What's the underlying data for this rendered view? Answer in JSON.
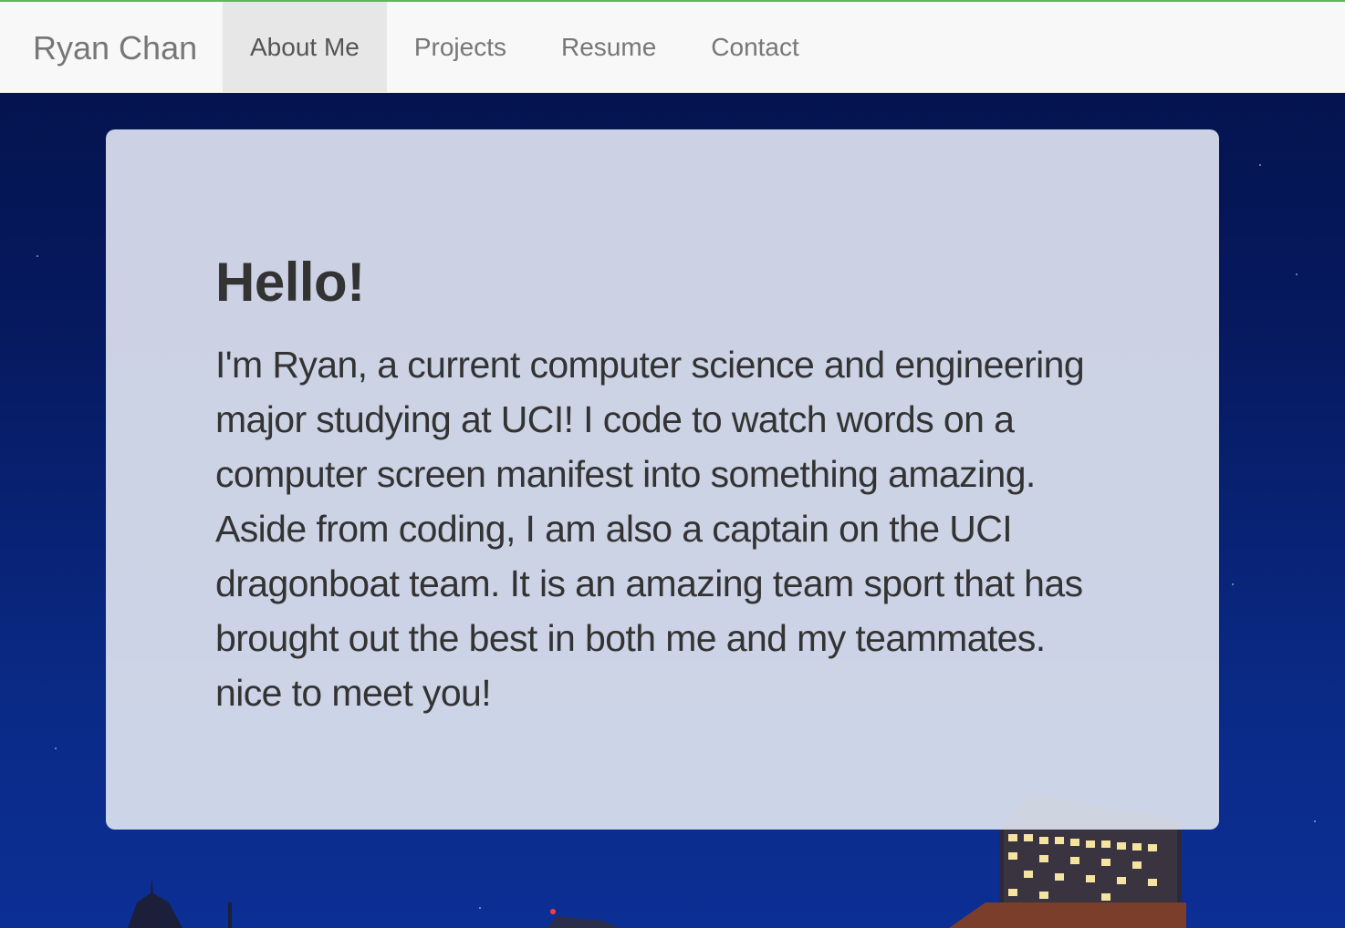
{
  "navbar": {
    "brand": "Ryan Chan",
    "items": [
      {
        "label": "About Me",
        "active": true
      },
      {
        "label": "Projects",
        "active": false
      },
      {
        "label": "Resume",
        "active": false
      },
      {
        "label": "Contact",
        "active": false
      }
    ],
    "accent_color": "#5cb85c"
  },
  "hero": {
    "heading": "Hello!",
    "body": "I'm Ryan, a current computer science and engineering major studying at UCI! I code to watch words on a computer screen manifest into something amazing. Aside from coding, I am also a captain on the UCI dragonboat team. It is an amazing team sport that has brought out the best in both me and my teammates. nice to meet you!"
  },
  "background": {
    "description_colors": {
      "sky_top": "#04124a",
      "sky_bottom": "#0c2f95"
    }
  }
}
